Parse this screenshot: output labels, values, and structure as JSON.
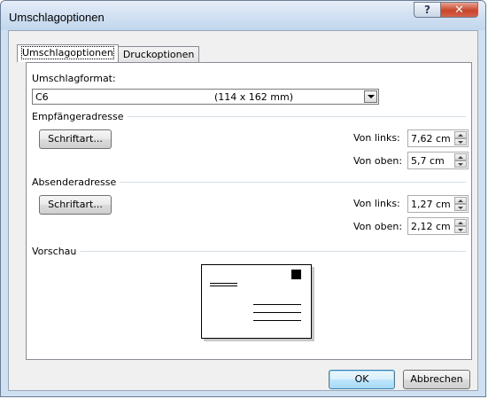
{
  "window": {
    "title": "Umschlagoptionen",
    "help_glyph": "?",
    "close_glyph": "✕"
  },
  "tabs": [
    {
      "label": "Umschlagoptionen",
      "active": true
    },
    {
      "label": "Druckoptionen",
      "active": false
    }
  ],
  "envelope_format": {
    "label": "Umschlagformat:",
    "size_name": "C6",
    "size_dims": "(114 x 162 mm)"
  },
  "recipient": {
    "group_label": "Empfängeradresse",
    "font_button": "Schriftart...",
    "from_left_label": "Von links:",
    "from_left_value": "7,62 cm",
    "from_top_label": "Von oben:",
    "from_top_value": "5,7 cm"
  },
  "sender": {
    "group_label": "Absenderadresse",
    "font_button": "Schriftart...",
    "from_left_label": "Von links:",
    "from_left_value": "1,27 cm",
    "from_top_label": "Von oben:",
    "from_top_value": "2,12 cm"
  },
  "preview": {
    "group_label": "Vorschau"
  },
  "footer": {
    "ok_label": "OK",
    "cancel_label": "Abbrechen"
  },
  "icons": [
    "help-icon",
    "close-icon",
    "dropdown-arrow-icon",
    "spin-up-icon",
    "spin-down-icon",
    "stamp-icon"
  ]
}
